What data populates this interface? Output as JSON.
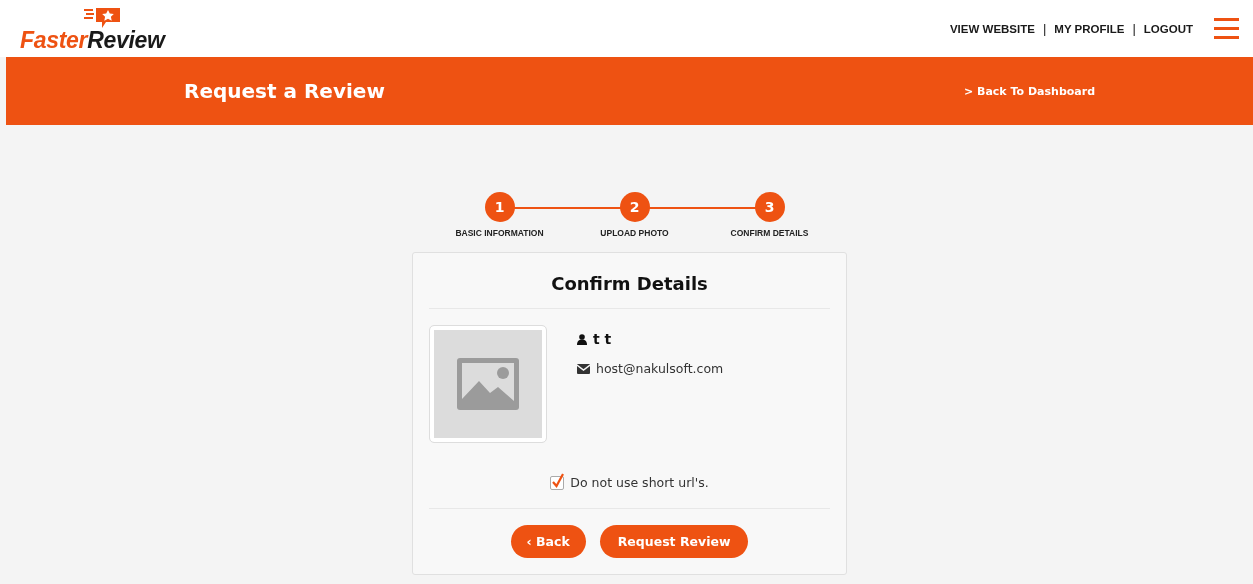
{
  "logo": {
    "part_1": "Faster",
    "part_2": "Review"
  },
  "nav": [
    {
      "kind": "link",
      "label": "VIEW WEBSITE"
    },
    {
      "kind": "separator",
      "label": "|"
    },
    {
      "kind": "link",
      "label": "MY PROFILE"
    },
    {
      "kind": "separator",
      "label": "|"
    },
    {
      "kind": "link",
      "label": "LOGOUT"
    }
  ],
  "banner": {
    "title": "Request a Review",
    "back_link": "> Back To Dashboard"
  },
  "steps": [
    {
      "number": "1",
      "label": "BASIC INFORMATION"
    },
    {
      "number": "2",
      "label": "UPLOAD PHOTO"
    },
    {
      "number": "3",
      "label": "CONFIRM DETAILS"
    }
  ],
  "card": {
    "title": "Confirm Details",
    "name": "t t",
    "email": "host@nakulsoft.com",
    "option": {
      "label": "Do not use short url's.",
      "checked": true
    },
    "buttons": [
      {
        "kind": "back",
        "label": "‹ Back"
      },
      {
        "kind": "primary",
        "label": "Request Review"
      }
    ]
  }
}
